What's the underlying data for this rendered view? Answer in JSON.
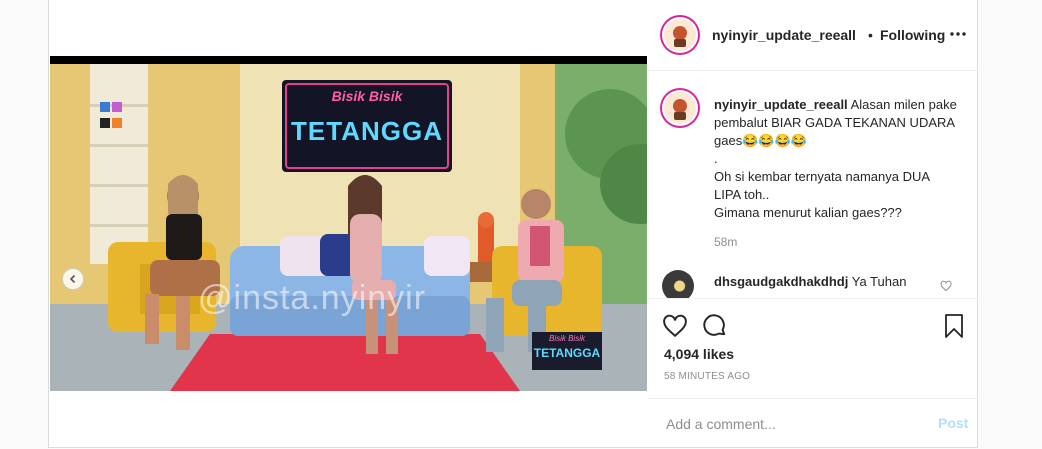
{
  "post": {
    "username": "nyinyir_update_reeall",
    "following": "Following",
    "separator": "•",
    "caption_lines": [
      "Alasan milen pake pembalut BIAR GADA TEKANAN UDARA gaes😂😂😂😂",
      ".",
      "Oh si kembar ternyata namanya DUA LIPA toh..",
      "Gimana menurut kalian gaes???"
    ],
    "time_ago": "58m",
    "likes": "4,094 likes",
    "posted": "58 MINUTES AGO"
  },
  "comment": {
    "username": "dhsgaudgakdhakdhdj",
    "text": "Ya Tuhan"
  },
  "add_comment": {
    "placeholder": "Add a comment...",
    "post_label": "Post"
  },
  "media": {
    "sign_top": "Bisik Bisik",
    "sign_main": "TETANGGA",
    "watermark": "@insta.nyinyir",
    "corner_logo_top": "Bisik Bisik",
    "corner_logo_main": "TETANGGA",
    "slide_count": 2,
    "active_slide": 2
  },
  "colors": {
    "link": "#b2dffc",
    "muted": "#8e8e8e",
    "text": "#262626",
    "border": "#dbdbdb"
  },
  "icons": [
    "more-icon",
    "heart-icon",
    "comment-icon",
    "bookmark-icon",
    "chevron-left-icon"
  ]
}
